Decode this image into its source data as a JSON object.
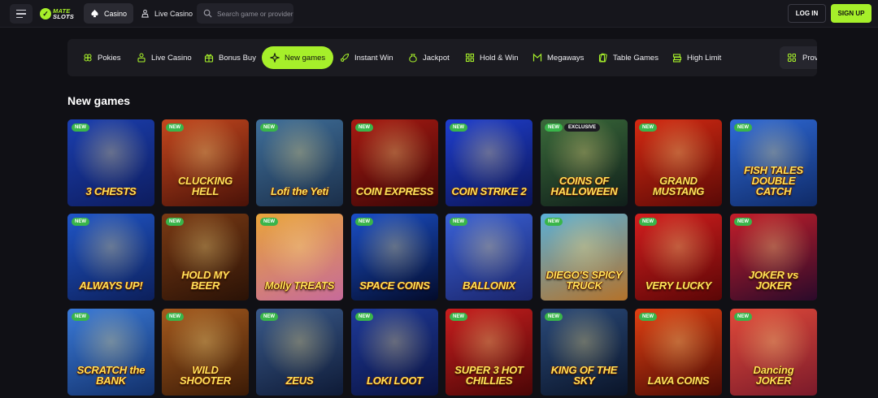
{
  "header": {
    "logo_top": "MATE",
    "logo_bottom": "SLOTS",
    "tabs": [
      {
        "label": "Casino",
        "active": true
      },
      {
        "label": "Live Casino",
        "active": false
      }
    ],
    "search_placeholder": "Search game or provider",
    "login_label": "LOG IN",
    "signup_label": "SIGN UP",
    "accent_color": "#a6ef2a"
  },
  "categories": {
    "items": [
      {
        "label": "Pokies",
        "icon": "clover-icon"
      },
      {
        "label": "Live Casino",
        "icon": "cards-person-icon"
      },
      {
        "label": "Bonus Buy",
        "icon": "bonus-icon"
      },
      {
        "label": "New games",
        "icon": "sparkle-icon",
        "active": true
      },
      {
        "label": "Instant Win",
        "icon": "rocket-icon"
      },
      {
        "label": "Jackpot",
        "icon": "moneybag-icon"
      },
      {
        "label": "Hold & Win",
        "icon": "grid-icon"
      },
      {
        "label": "Megaways",
        "icon": "megaways-icon"
      },
      {
        "label": "Table Games",
        "icon": "cards-icon"
      },
      {
        "label": "High Limit",
        "icon": "stack-icon"
      }
    ],
    "providers_label": "Providers",
    "filter_icon": "filter-icon"
  },
  "section": {
    "title": "New games"
  },
  "games": [
    {
      "title": "3 CHESTS",
      "badge": "NEW",
      "colors": [
        "#1b3fb0",
        "#0d1c5e"
      ]
    },
    {
      "title": "CLUCKING HELL",
      "badge": "NEW",
      "colors": [
        "#c4471e",
        "#4a1208"
      ]
    },
    {
      "title": "Lofi the Yeti",
      "badge": "NEW",
      "colors": [
        "#3f6f9a",
        "#1b2f4a"
      ]
    },
    {
      "title": "COIN EXPRESS",
      "badge": "NEW",
      "colors": [
        "#a81a12",
        "#3a0606"
      ]
    },
    {
      "title": "COIN STRIKE 2",
      "badge": "NEW",
      "colors": [
        "#1f3fcf",
        "#0b1455"
      ]
    },
    {
      "title": "COINS OF HALLOWEEN",
      "badge": "NEW",
      "badge2": "EXCLUSIVE",
      "colors": [
        "#3a6a3a",
        "#101e1a"
      ]
    },
    {
      "title": "GRAND MUSTANG",
      "badge": "NEW",
      "colors": [
        "#d52a12",
        "#5a0906"
      ]
    },
    {
      "title": "FISH TALES DOUBLE CATCH",
      "badge": "NEW",
      "colors": [
        "#2f6ad8",
        "#0f2a66"
      ]
    },
    {
      "title": "ALWAYS UP!",
      "badge": "NEW",
      "colors": [
        "#2056c8",
        "#0c1f5a"
      ]
    },
    {
      "title": "HOLD MY BEER",
      "badge": "NEW",
      "colors": [
        "#7a3a14",
        "#2a1206"
      ]
    },
    {
      "title": "Molly TREATS",
      "badge": "NEW",
      "colors": [
        "#e9a43a",
        "#c66a9a"
      ]
    },
    {
      "title": "SPACE COINS",
      "badge": "NEW",
      "colors": [
        "#1a4fc8",
        "#030b2a"
      ]
    },
    {
      "title": "BALLONIX",
      "badge": "NEW",
      "colors": [
        "#3a62d8",
        "#1a246a"
      ]
    },
    {
      "title": "DIEGO'S SPICY TRUCK",
      "badge": "NEW",
      "colors": [
        "#5ab0d8",
        "#b4722a"
      ]
    },
    {
      "title": "VERY LUCKY",
      "badge": "NEW",
      "colors": [
        "#d41e1e",
        "#5a0606"
      ]
    },
    {
      "title": "JOKER vs JOKER",
      "badge": "NEW",
      "colors": [
        "#c41e2a",
        "#2a0a2a"
      ]
    },
    {
      "title": "SCRATCH the BANK",
      "badge": "NEW",
      "colors": [
        "#3a7ad8",
        "#12306a"
      ]
    },
    {
      "title": "WILD SHOOTER",
      "badge": "NEW",
      "colors": [
        "#a55a1e",
        "#3a1a06"
      ]
    },
    {
      "title": "ZEUS",
      "badge": "NEW",
      "colors": [
        "#3a5a8a",
        "#0e1a36"
      ]
    },
    {
      "title": "LOKI LOOT",
      "badge": "NEW",
      "colors": [
        "#1e3a9a",
        "#0a1240"
      ]
    },
    {
      "title": "SUPER 3 HOT CHILLIES",
      "badge": "NEW",
      "colors": [
        "#c81e1e",
        "#4a0606"
      ]
    },
    {
      "title": "KING OF THE SKY",
      "badge": "NEW",
      "colors": [
        "#2a4a7a",
        "#0a1428"
      ]
    },
    {
      "title": "LAVA COINS",
      "badge": "NEW",
      "colors": [
        "#e04012",
        "#4a0a04"
      ]
    },
    {
      "title": "Dancing JOKER",
      "badge": "NEW",
      "colors": [
        "#e24a3a",
        "#7a1a2a"
      ]
    }
  ]
}
